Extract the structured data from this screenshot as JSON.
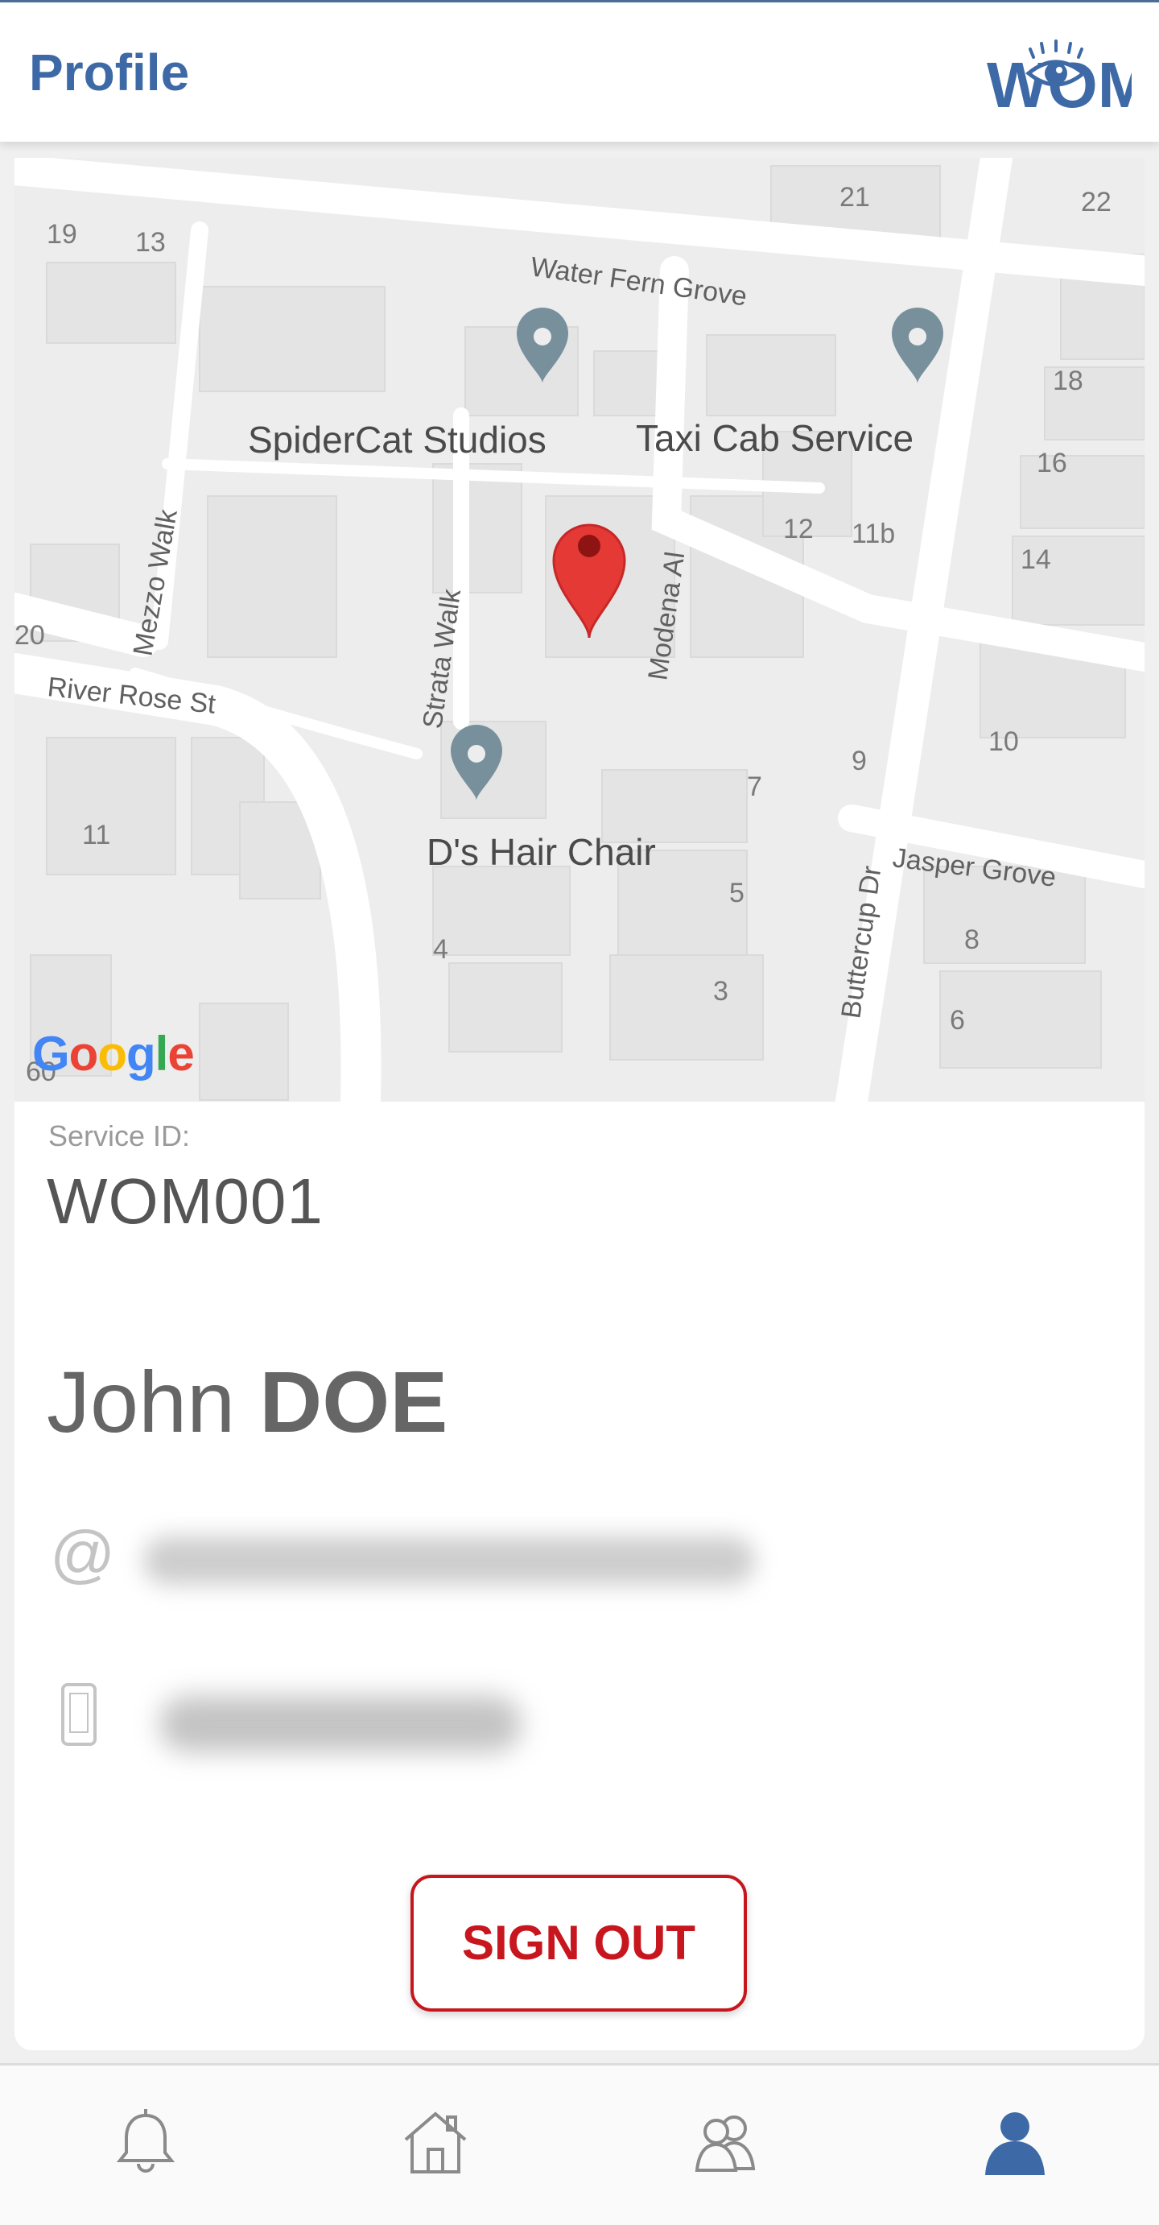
{
  "header": {
    "title": "Profile",
    "logo_text": "WOM"
  },
  "map": {
    "places": [
      "SpiderCat Studios",
      "Taxi Cab Service",
      "D's Hair Chair"
    ],
    "streets": [
      "Water Fern Grove",
      "Mezzo Walk",
      "Strata Walk",
      "Modena Al",
      "River Rose St",
      "Jasper Grove",
      "Buttercup Dr"
    ],
    "numbers": [
      "19",
      "13",
      "21",
      "22",
      "18",
      "16",
      "14",
      "12",
      "11b",
      "10",
      "9",
      "7",
      "5",
      "3",
      "4",
      "11",
      "8",
      "6",
      "20",
      "60"
    ],
    "attribution": "Google"
  },
  "profile": {
    "service_id_label": "Service ID:",
    "service_id": "WOM001",
    "first_name": "John",
    "last_name": "DOE"
  },
  "actions": {
    "sign_out": "SIGN OUT"
  },
  "colors": {
    "brand": "#3d6aa6",
    "danger": "#c7161e",
    "map_pin": "#e53935",
    "poi_pin": "#78909c"
  },
  "tabs": [
    "bell-icon",
    "home-icon",
    "contacts-icon",
    "profile-icon"
  ]
}
